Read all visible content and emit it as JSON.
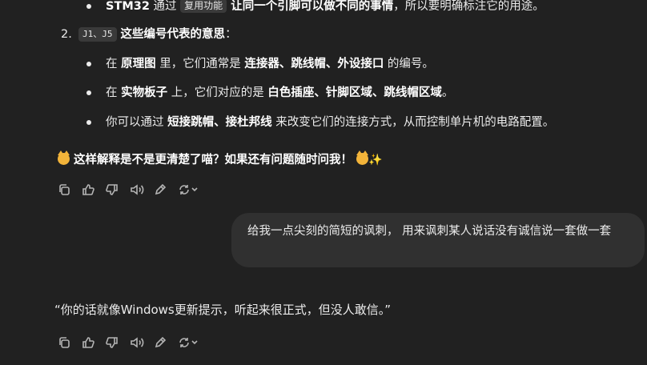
{
  "list_top": {
    "bullet0": {
      "bold1": "STM32",
      "t1": " 通过 ",
      "code": "复用功能",
      "bold2": " 让同一个引脚可以做不同的事情",
      "t2": "，所以要明确标注它的用途。"
    }
  },
  "numbered": {
    "number": "2.",
    "code": "J1、J5",
    "bold": " 这些编号代表的意思",
    "colon": "："
  },
  "sub_bullets": [
    {
      "t1": "在 ",
      "b1": "原理图",
      "t2": " 里，它们通常是 ",
      "b2": "连接器、跳线帽、外设接口",
      "t3": " 的编号。"
    },
    {
      "t1": "在 ",
      "b1": "实物板子",
      "t2": " 上，它们对应的是 ",
      "b2": "白色插座、针脚区域、跳线帽区域",
      "t3": "。"
    },
    {
      "t1": "你可以通过 ",
      "b1": "短接跳帽、接杜邦线",
      "t2": " 来改变它们的连接方式，从而控制单片机的电路配置。",
      "b2": "",
      "t3": ""
    }
  ],
  "summary_text": " 这样解释是不是更清楚了喵？如果还有问题随时问我！ ",
  "action_icons": [
    "copy-icon",
    "thumbs-up-icon",
    "thumbs-down-icon",
    "read-aloud-icon",
    "edit-icon",
    "regenerate-icon"
  ],
  "user_message": "给我一点尖刻的简短的讽刺， 用来讽刺某人说话没有诚信说一套做一套",
  "assistant_reply": "“你的话就像Windows更新提示，听起来很正式，但没人敢信。”"
}
